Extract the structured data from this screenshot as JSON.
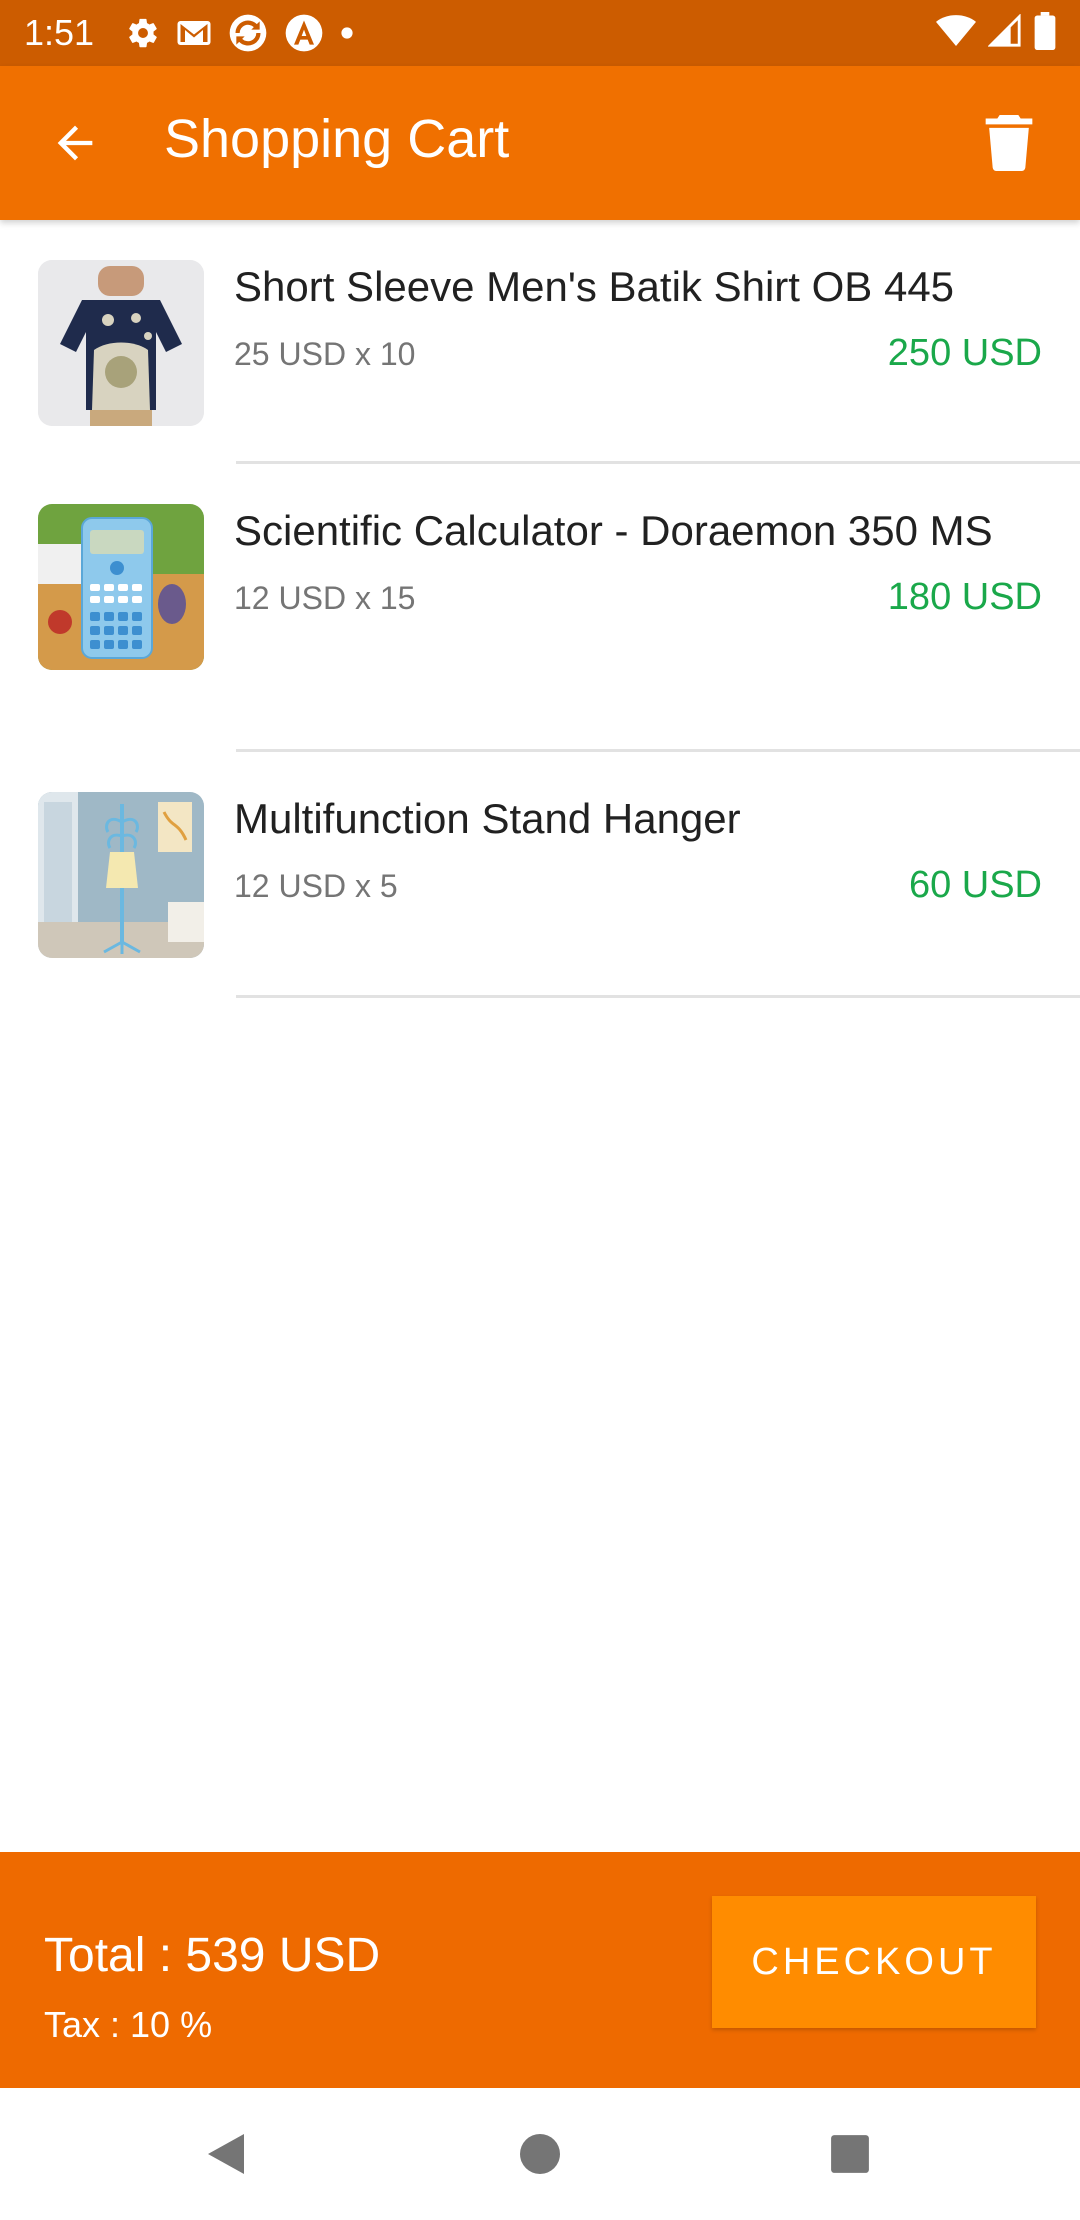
{
  "status_bar": {
    "time": "1:51",
    "icons": [
      "gear-icon",
      "gmail-icon",
      "sync-app-icon",
      "a-app-icon",
      "dot-icon"
    ],
    "right_icons": [
      "wifi-icon",
      "signal-icon",
      "battery-icon"
    ]
  },
  "app_bar": {
    "title": "Shopping Cart",
    "back_icon": "arrow-back-icon",
    "delete_icon": "trash-icon"
  },
  "cart": {
    "items": [
      {
        "name": "Short Sleeve Men's Batik Shirt OB 445",
        "qty_text": "25 USD x 10",
        "total": "250 USD",
        "image": "batik-shirt-image"
      },
      {
        "name": "Scientific Calculator - Doraemon 350 MS",
        "qty_text": "12 USD x 15",
        "total": "180 USD",
        "image": "calculator-image"
      },
      {
        "name": "Multifunction Stand Hanger",
        "qty_text": "12 USD x 5",
        "total": "60 USD",
        "image": "stand-hanger-image"
      }
    ]
  },
  "footer": {
    "total": "Total : 539 USD",
    "tax": "Tax : 10 %",
    "checkout_label": "CHECKOUT"
  },
  "nav_bar": {
    "back": "nav-back-icon",
    "home": "nav-home-icon",
    "recents": "nav-recents-icon"
  },
  "colors": {
    "status_bar": "#cc5c00",
    "app_bar": "#f07000",
    "footer": "#ee6a00",
    "checkout_button": "#ff8c00",
    "price_green": "#1aa84a"
  }
}
